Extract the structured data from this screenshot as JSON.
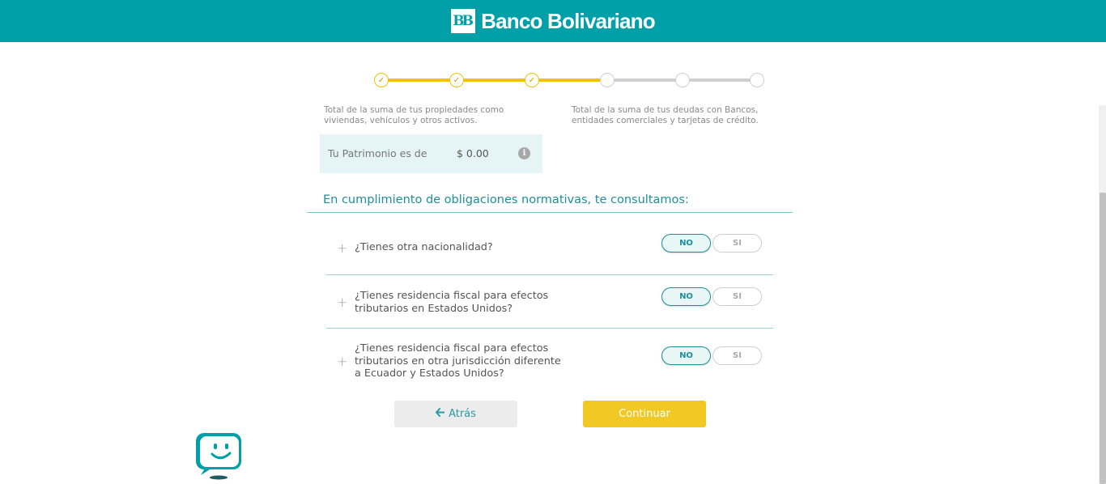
{
  "header": {
    "brand": "Banco Bolivariano",
    "logo_mark": "BB"
  },
  "stepper": {
    "total_steps": 6,
    "completed_steps": 3,
    "check_icon": "✓"
  },
  "notes": {
    "assets": "Total de la suma de tus propiedades como viviendas, vehículos y otros activos.",
    "debts": "Total de la suma de tus deudas con Bancos, entidades comerciales y tarjetas de crédito."
  },
  "patrimonio": {
    "label": "Tu Patrimonio es de",
    "value": "$ 0.00",
    "info_icon": "i"
  },
  "compliance": {
    "title": "En cumplimiento de obligaciones normativas, te consultamos:",
    "questions": [
      {
        "text": "¿Tienes otra nacionalidad?",
        "no_label": "NO",
        "si_label": "SI",
        "selected": "NO"
      },
      {
        "text": "¿Tienes residencia fiscal para efectos tributarios en Estados Unidos?",
        "no_label": "NO",
        "si_label": "SI",
        "selected": "NO"
      },
      {
        "text": "¿Tienes residencia fiscal para efectos tributarios en otra jurisdicción diferente a Ecuador y Estados Unidos?",
        "no_label": "NO",
        "si_label": "SI",
        "selected": "NO"
      }
    ],
    "expand_icon": "+"
  },
  "actions": {
    "back_label": "Atrás",
    "back_icon": "🡐",
    "next_label": "Continuar"
  },
  "colors": {
    "brand_teal": "#00a0a9",
    "accent_yellow": "#f2c924",
    "text_teal": "#1f8e9a"
  }
}
